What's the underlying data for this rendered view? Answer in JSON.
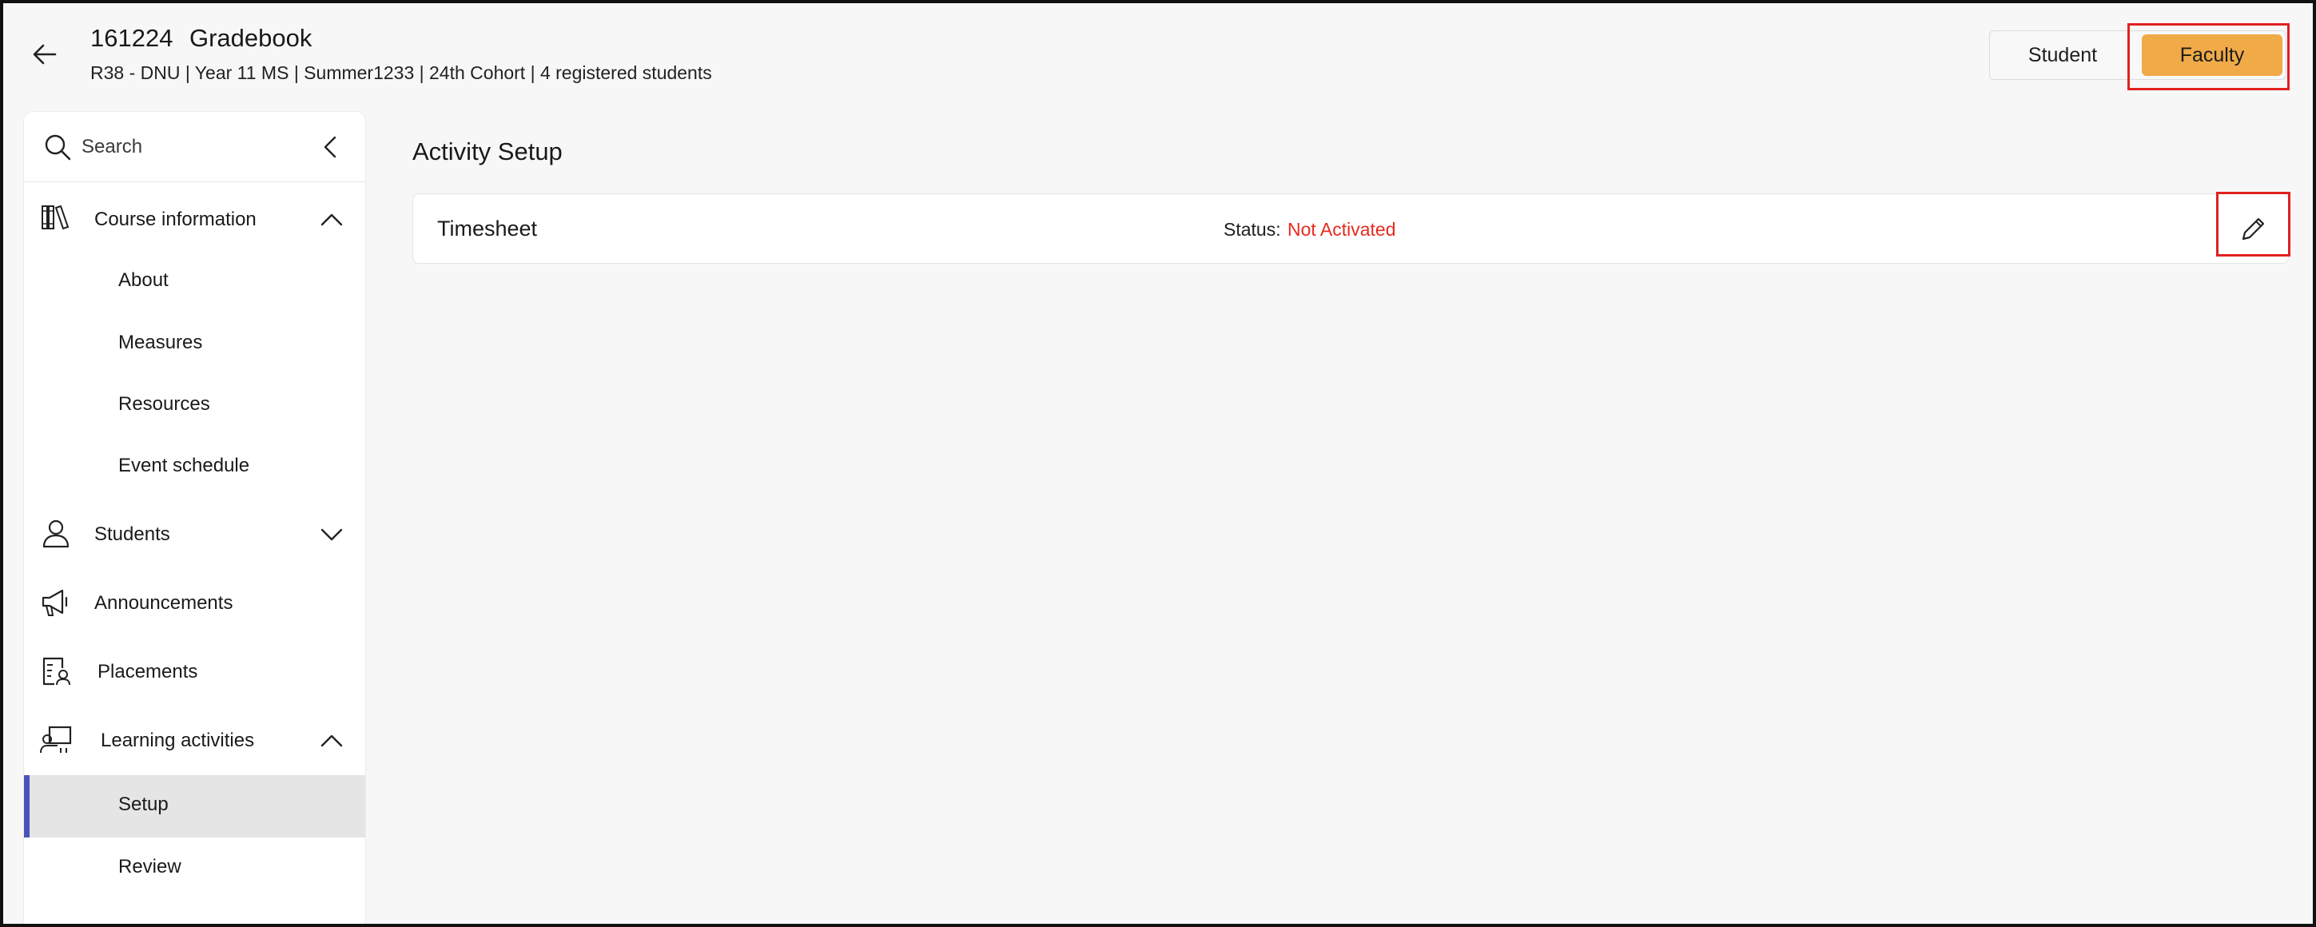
{
  "header": {
    "course_code": "161224",
    "course_title": "Gradebook",
    "course_meta": "R38 - DNU | Year 11 MS | Summer1233 | 24th Cohort | 4 registered students",
    "toggle": {
      "student_label": "Student",
      "faculty_label": "Faculty",
      "selected": "Faculty"
    }
  },
  "sidebar": {
    "search": {
      "placeholder": "Search"
    },
    "sections": [
      {
        "label": "Course information",
        "icon": "library-books-icon",
        "expanded": true,
        "items": [
          "About",
          "Measures",
          "Resources",
          "Event schedule"
        ]
      },
      {
        "label": "Students",
        "icon": "person-icon",
        "expanded": false
      },
      {
        "label": "Announcements",
        "icon": "megaphone-icon"
      },
      {
        "label": "Placements",
        "icon": "placement-icon"
      },
      {
        "label": "Learning activities",
        "icon": "teacher-board-icon",
        "expanded": true,
        "items": [
          "Setup",
          "Review"
        ],
        "active_item": "Setup"
      }
    ]
  },
  "main": {
    "title": "Activity Setup",
    "activity": {
      "name": "Timesheet",
      "status_label": "Status:",
      "status_value": "Not Activated"
    }
  },
  "colors": {
    "accent": "#f0aa48",
    "active_bar": "#4a54b8",
    "status_inactive": "#e52b1f",
    "highlight_box": "#e0211f"
  }
}
